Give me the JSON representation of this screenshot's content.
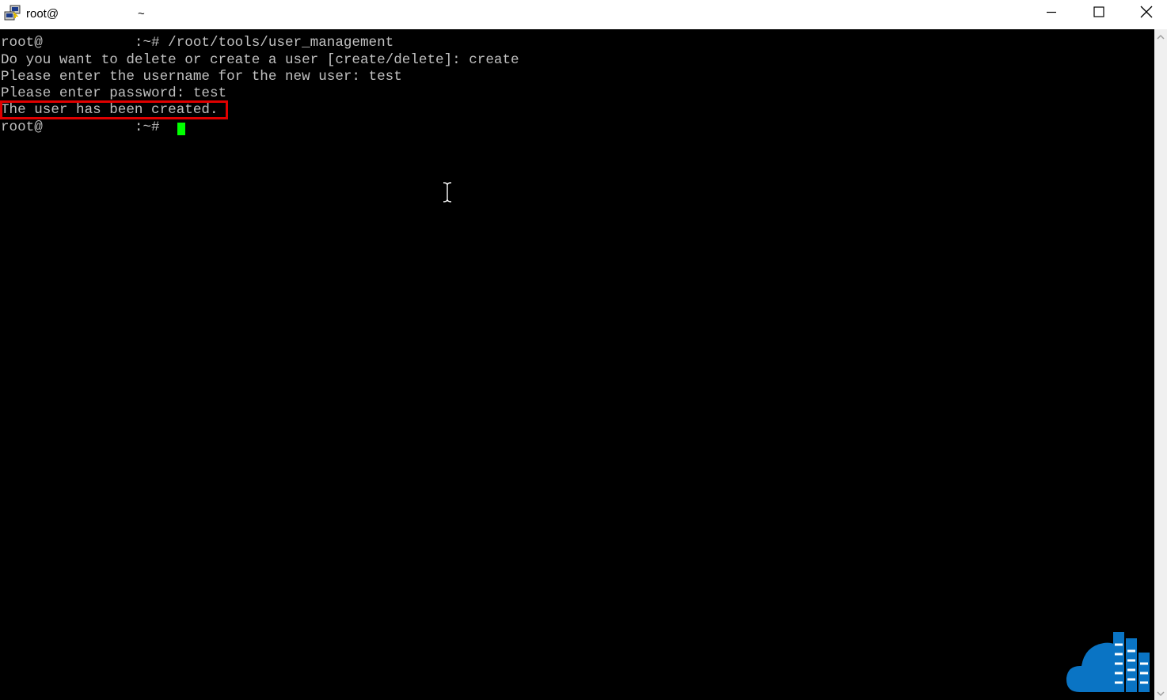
{
  "window": {
    "title": "root@",
    "title_suffix": "~",
    "icon": "putty-icon",
    "controls": {
      "minimize_icon": "minimize-icon",
      "maximize_icon": "maximize-icon",
      "close_icon": "close-icon"
    }
  },
  "terminal": {
    "lines": [
      "root@           :~# /root/tools/user_management",
      "Do you want to delete or create a user [create/delete]: create",
      "Please enter the username for the new user: test",
      "Please enter password: test",
      "The user has been created.",
      "root@           :~# "
    ],
    "highlighted_line_index": 4,
    "text_color": "#c0c0c0",
    "background_color": "#000000",
    "cursor_color": "#00ff00",
    "highlight_color": "#e00000"
  },
  "scrollbar": {
    "up_icon": "scroll-up-arrow-icon",
    "down_icon": "scroll-down-arrow-icon"
  },
  "watermark": {
    "icon": "cloud-building-logo",
    "color": "#0a74c4"
  }
}
